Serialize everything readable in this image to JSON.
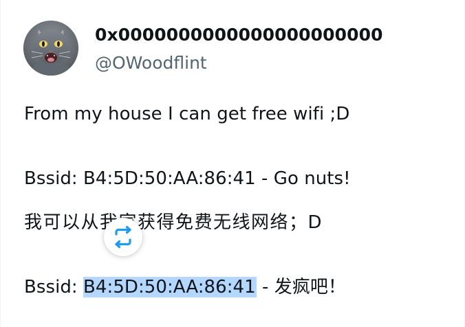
{
  "author": {
    "display_name": "0x0000000000000000000000",
    "handle": "@OWoodflint",
    "avatar": "cat-avatar"
  },
  "tweet": {
    "line1": "From my house I can get free wifi ;D",
    "line2": "Bssid: B4:5D:50:AA:86:41 - Go nuts!",
    "line3": "我可以从我家获得免费无线网络；D",
    "line4_prefix": "Bssid: ",
    "line4_selected": "B4:5D:50:AA:86:41",
    "line4_suffix": " - 发疯吧！"
  },
  "controls": {
    "retweet_icon": "retweet-icon",
    "accent_color": "#1d9bf0"
  },
  "colors": {
    "text": "#0f1419",
    "muted": "#536471",
    "selection": "#b3d7ff"
  }
}
